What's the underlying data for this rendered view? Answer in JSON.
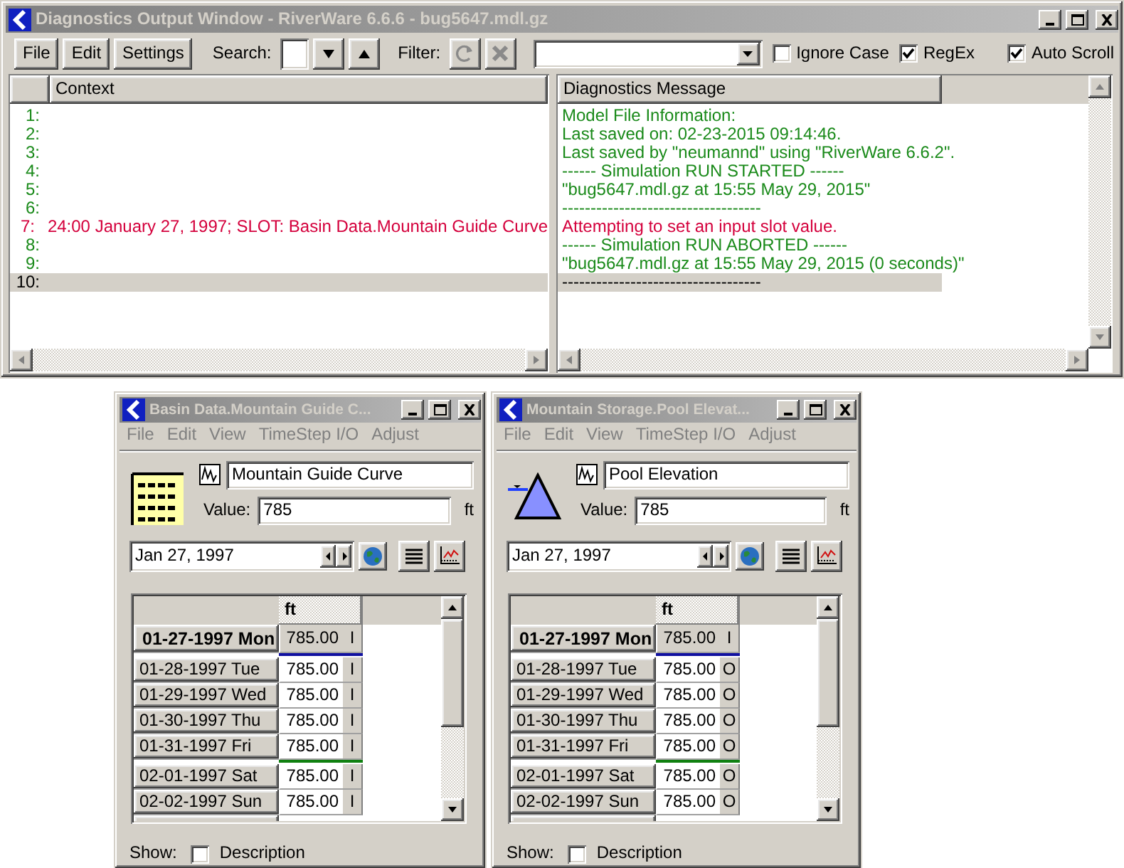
{
  "main_window": {
    "title": "Diagnostics Output Window - RiverWare 6.6.6 - bug5647.mdl.gz",
    "toolbar": {
      "menus": [
        "File",
        "Edit",
        "Settings"
      ],
      "search_label": "Search:",
      "filter_label": "Filter:",
      "filter_enabled": false,
      "options": [
        {
          "label": "Ignore Case",
          "checked": false
        },
        {
          "label": "RegEx",
          "checked": true
        },
        {
          "label": "Auto Scroll",
          "checked": true
        }
      ]
    },
    "context_pane": {
      "header": "Context",
      "rows": [
        {
          "number": "1:",
          "kind": "info",
          "selected": false
        },
        {
          "number": "2:",
          "kind": "info",
          "selected": false
        },
        {
          "number": "3:",
          "kind": "info",
          "selected": false
        },
        {
          "number": "4:",
          "kind": "info",
          "selected": false
        },
        {
          "number": "5:",
          "kind": "info",
          "selected": false
        },
        {
          "number": "6:",
          "kind": "info",
          "selected": false
        },
        {
          "number": "7:",
          "kind": "error",
          "selected": false,
          "text": "24:00 January 27, 1997; SLOT: Basin Data.Mountain Guide Curve"
        },
        {
          "number": "8:",
          "kind": "info",
          "selected": false
        },
        {
          "number": "9:",
          "kind": "info",
          "selected": false
        },
        {
          "number": "10:",
          "selected": true
        }
      ]
    },
    "message_pane": {
      "header": "Diagnostics Message",
      "rows": [
        {
          "text": "Model File Information:",
          "kind": "info",
          "selected": false
        },
        {
          "text": "Last saved on: 02-23-2015 09:14:46.",
          "kind": "info",
          "selected": false
        },
        {
          "text": "Last saved by \"neumannd\" using \"RiverWare 6.6.2\".",
          "kind": "info",
          "selected": false
        },
        {
          "text": "------ Simulation RUN STARTED ------",
          "kind": "info",
          "selected": false
        },
        {
          "text": "\"bug5647.mdl.gz at 15:55 May 29, 2015\"",
          "kind": "info",
          "selected": false
        },
        {
          "text": "-----------------------------------",
          "kind": "info",
          "selected": false
        },
        {
          "text": "Attempting to set an input slot value.",
          "kind": "error",
          "selected": false
        },
        {
          "text": "------ Simulation RUN ABORTED ------",
          "kind": "info",
          "selected": false
        },
        {
          "text": "\"bug5647.mdl.gz at 15:55 May 29, 2015 (0 seconds)\"",
          "kind": "info",
          "selected": false
        },
        {
          "text": "-----------------------------------",
          "selected": true
        }
      ]
    }
  },
  "slot_windows": [
    {
      "title": "Basin Data.Mountain Guide C...",
      "menus": [
        "File",
        "Edit",
        "View",
        "TimeStep I/O",
        "Adjust"
      ],
      "menus_disabled": true,
      "kind": "data_table",
      "slot_name": "Mountain Guide Curve",
      "value_label": "Value:",
      "value": "785",
      "unit": "ft",
      "date": "Jan 27, 1997",
      "column_header": "ft",
      "rows": [
        {
          "date": "01-27-1997 Mon",
          "value": "785.00",
          "flag": "I",
          "kind": "current"
        },
        {
          "date": "01-28-1997 Tue",
          "value": "785.00",
          "flag": "I",
          "kind": "normal"
        },
        {
          "date": "01-29-1997 Wed",
          "value": "785.00",
          "flag": "I",
          "kind": "normal"
        },
        {
          "date": "01-30-1997 Thu",
          "value": "785.00",
          "flag": "I",
          "kind": "normal"
        },
        {
          "date": "01-31-1997 Fri",
          "value": "785.00",
          "flag": "I",
          "kind": "run_end"
        },
        {
          "date": "02-01-1997 Sat",
          "value": "785.00",
          "flag": "I",
          "kind": "normal"
        },
        {
          "date": "02-02-1997 Sun",
          "value": "785.00",
          "flag": "I",
          "kind": "normal"
        }
      ],
      "show_label": "Show:",
      "options": [
        {
          "label": "Description",
          "checked": false
        }
      ]
    },
    {
      "title": "Mountain Storage.Pool Elevat...",
      "menus": [
        "File",
        "Edit",
        "View",
        "TimeStep I/O",
        "Adjust"
      ],
      "menus_disabled": true,
      "kind": "reservoir",
      "slot_name": "Pool Elevation",
      "value_label": "Value:",
      "value": "785",
      "unit": "ft",
      "date": "Jan 27, 1997",
      "column_header": "ft",
      "rows": [
        {
          "date": "01-27-1997 Mon",
          "value": "785.00",
          "flag": "I",
          "kind": "current"
        },
        {
          "date": "01-28-1997 Tue",
          "value": "785.00",
          "flag": "O",
          "kind": "normal"
        },
        {
          "date": "01-29-1997 Wed",
          "value": "785.00",
          "flag": "O",
          "kind": "normal"
        },
        {
          "date": "01-30-1997 Thu",
          "value": "785.00",
          "flag": "O",
          "kind": "normal"
        },
        {
          "date": "01-31-1997 Fri",
          "value": "785.00",
          "flag": "O",
          "kind": "run_end"
        },
        {
          "date": "02-01-1997 Sat",
          "value": "785.00",
          "flag": "O",
          "kind": "normal"
        },
        {
          "date": "02-02-1997 Sun",
          "value": "785.00",
          "flag": "O",
          "kind": "normal"
        }
      ],
      "show_label": "Show:",
      "options": [
        {
          "label": "Description",
          "checked": false
        }
      ]
    }
  ]
}
